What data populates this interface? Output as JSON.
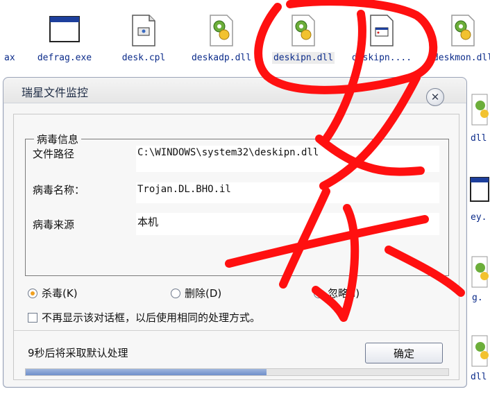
{
  "files": [
    {
      "name": "ax",
      "icon": "window-file-icon"
    },
    {
      "name": "defrag.exe",
      "icon": "window-exe-icon"
    },
    {
      "name": "desk.cpl",
      "icon": "control-panel-file-icon"
    },
    {
      "name": "deskadp.dll",
      "icon": "dll-gear-icon"
    },
    {
      "name": "deskipn.dll",
      "icon": "dll-gear-icon"
    },
    {
      "name": "deskipn....",
      "icon": "document-window-icon"
    },
    {
      "name": "deskmon.dll",
      "icon": "dll-gear-icon"
    }
  ],
  "side_labels": [
    "dll",
    "ey.",
    "g.",
    "dll"
  ],
  "dialog": {
    "title": "瑞星文件监控",
    "group_title": "病毒信息",
    "fields": [
      {
        "label": "文件路径",
        "value": "C:\\WINDOWS\\system32\\deskipn.dll"
      },
      {
        "label": "病毒名称：",
        "value": "Trojan.DL.BHO.il"
      },
      {
        "label": "病毒来源",
        "value": "本机"
      }
    ],
    "options": [
      {
        "label": "杀毒(K)",
        "selected": true
      },
      {
        "label": "删除(D)",
        "selected": false
      },
      {
        "label": "忽略(I)",
        "selected": false
      }
    ],
    "remember_checkbox": "不再显示该对话框，以后使用相同的处理方式。",
    "countdown": "9秒后将采取默认处理",
    "ok_button": "确定",
    "progress": 0.57
  },
  "colors": {
    "annotation": "#ff1010",
    "file_label": "#0b2b8a",
    "radio_selected": "#f0a020"
  }
}
